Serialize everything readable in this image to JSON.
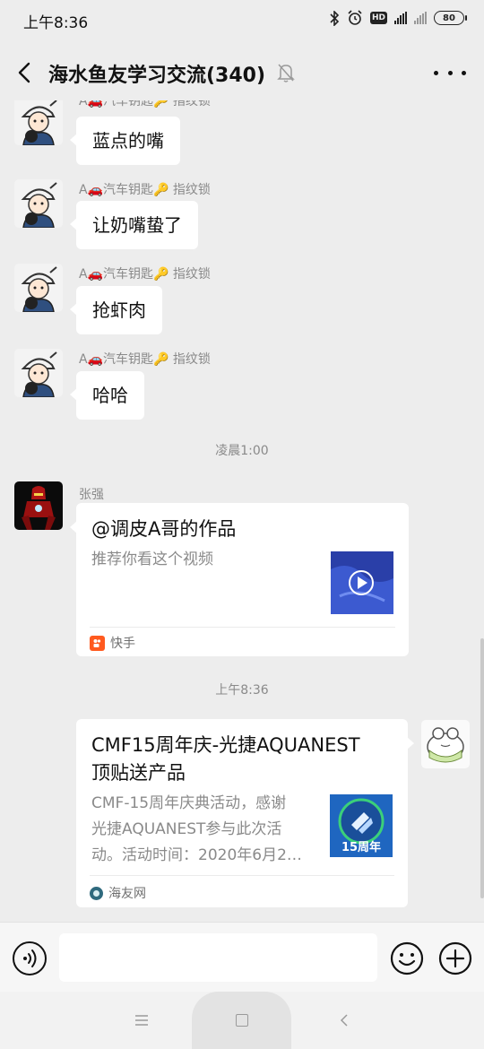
{
  "status": {
    "time": "上午8:36",
    "battery": "80"
  },
  "header": {
    "title": "海水鱼友学习交流(340)"
  },
  "messages": [
    {
      "sender": "A🚗汽车钥匙🔑 指纹锁",
      "text": "蓝点的嘴"
    },
    {
      "sender": "A🚗汽车钥匙🔑 指纹锁",
      "text": "让奶嘴蛰了"
    },
    {
      "sender": "A🚗汽车钥匙🔑 指纹锁",
      "text": "抢虾肉"
    },
    {
      "sender": "A🚗汽车钥匙🔑 指纹锁",
      "text": "哈哈"
    }
  ],
  "time_sep_1": "凌晨1:00",
  "video_card": {
    "sender": "张强",
    "title": "@调皮A哥的作品",
    "desc": "推荐你看这个视频",
    "source": "快手"
  },
  "time_sep_2": "上午8:36",
  "link_card": {
    "title_line1": "CMF15周年庆-光捷AQUANEST",
    "title_line2": "顶贴送产品",
    "desc_line1": "CMF-15周年庆典活动，感谢",
    "desc_line2": "光捷AQUANEST参与此次活",
    "desc_line3": "动。活动时间：2020年6月2…",
    "thumb_text": "15周年",
    "source": "海友网"
  },
  "input": {
    "placeholder": ""
  },
  "icons": {
    "back": "back-arrow-icon",
    "mute": "bell-muted-icon",
    "more": "more-dots-icon",
    "voice": "voice-icon",
    "emoji": "emoji-icon",
    "plus": "plus-icon"
  },
  "colors": {
    "background": "#ededed",
    "bubble": "#ffffff",
    "meta_text": "#8a8a8a",
    "kuaishou": "#ff5a1f"
  }
}
